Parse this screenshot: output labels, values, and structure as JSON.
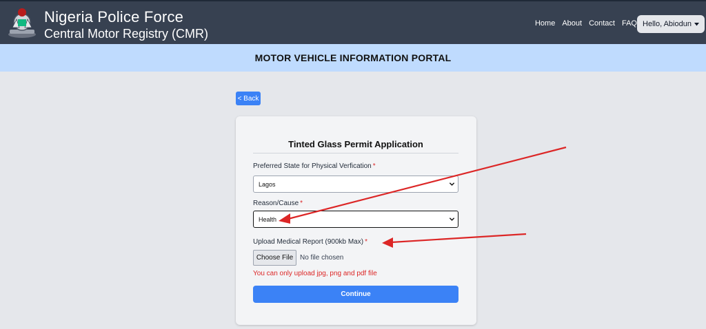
{
  "header": {
    "title": "Nigeria Police Force",
    "subtitle": "Central Motor Registry (CMR)",
    "nav": [
      "Home",
      "About",
      "Contact",
      "FAQ"
    ],
    "user_greeting": "Hello, Abiodun"
  },
  "banner": {
    "title": "MOTOR VEHICLE INFORMATION PORTAL"
  },
  "back_label": "< Back",
  "form": {
    "title": "Tinted Glass Permit Application",
    "state_label": "Preferred State for Physical Verfication",
    "state_value": "Lagos",
    "reason_label": "Reason/Cause",
    "reason_value": "Health",
    "upload_label": "Upload Medical Report (900kb Max)",
    "choose_file_label": "Choose File",
    "file_status": "No file chosen",
    "upload_error": "You can only upload jpg, png and pdf file",
    "required_mark": "*",
    "submit_label": "Continue"
  },
  "colors": {
    "header_bg": "#374151",
    "banner_bg": "#bfdbfe",
    "accent": "#3b82f6",
    "error": "#dc2626",
    "annotation_arrow": "#dc2626"
  }
}
